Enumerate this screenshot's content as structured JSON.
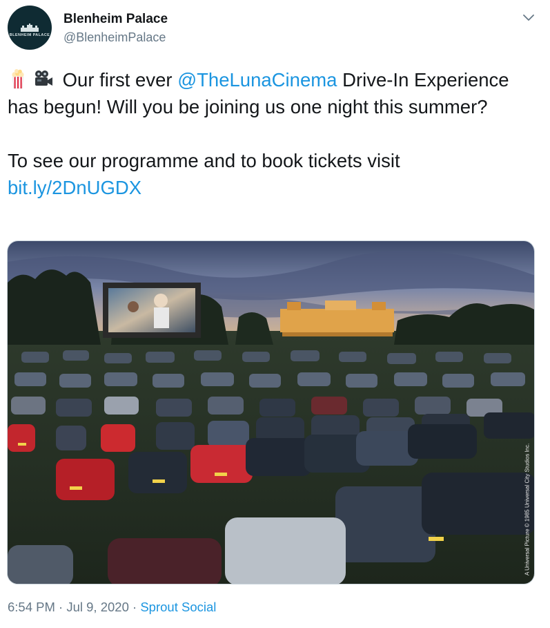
{
  "account": {
    "display_name": "Blenheim Palace",
    "handle": "@BlenheimPalace",
    "avatar_text": "BLENHEIM PALACE"
  },
  "tweet": {
    "line1_prefix": " Our first ever ",
    "mention": "@TheLunaCinema",
    "line1_suffix": " Drive-In Experience has begun! Will you be joining us one night this summer?",
    "line2": "To see our programme and to book tickets visit",
    "link": "bit.ly/2DnUGDX",
    "emoji": [
      "popcorn-icon",
      "movie-camera-icon"
    ]
  },
  "media": {
    "credit": "A Universal Picture © 1985 Universal City Studios Inc."
  },
  "footer": {
    "time": "6:54 PM",
    "separator": " · ",
    "date": "Jul 9, 2020",
    "source": "Sprout Social"
  },
  "colors": {
    "link": "#1b95e0",
    "text": "#14171a",
    "secondary": "#657786",
    "avatar_bg": "#0f2b33"
  }
}
